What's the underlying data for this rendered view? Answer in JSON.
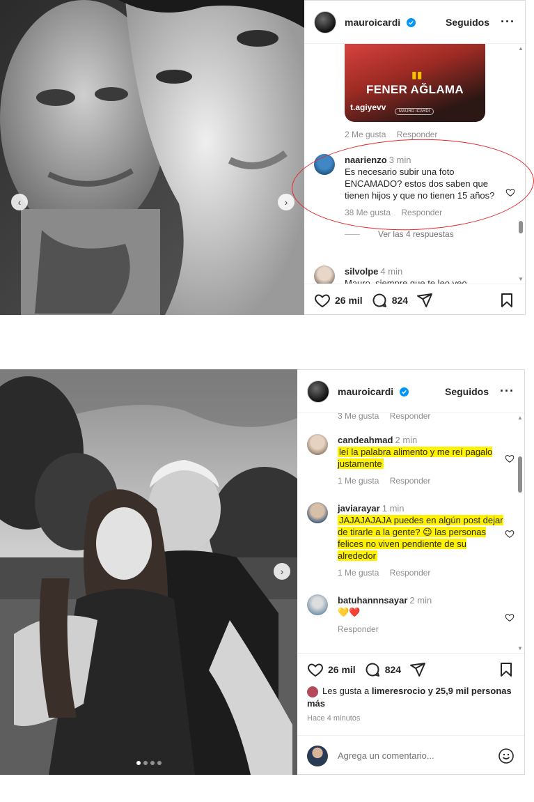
{
  "post1": {
    "header": {
      "username": "mauroicardi",
      "follow_label": "Seguidos",
      "more_label": "···"
    },
    "banner": {
      "title": "FENER AĞLAMA",
      "handle": "t.agiyevv",
      "tag": "MAURO ICARDI",
      "marks": "▮▮"
    },
    "comment_prev": {
      "likes": "2 Me gusta",
      "reply": "Responder"
    },
    "comment_main": {
      "user": "naarienzo",
      "time": "3 min",
      "text": "Es necesario subir una foto ENCAMADO? estos dos saben que tienen hijos y que no tienen 15 años?",
      "likes": "38 Me gusta",
      "reply": "Responder",
      "view_replies": "Ver las 4 respuestas"
    },
    "comment_next": {
      "user": "silvolpe",
      "time": "4 min",
      "text": "Mauro, siempre que te leo veo"
    },
    "actions": {
      "likes": "26 mil",
      "comments": "824"
    },
    "nav": {
      "prev": "‹",
      "next": "›"
    }
  },
  "post2": {
    "header": {
      "username": "mauroicardi",
      "follow_label": "Seguidos",
      "more_label": "···"
    },
    "comment_prev": {
      "likes": "3 Me gusta",
      "reply": "Responder"
    },
    "comments": [
      {
        "user": "candeahmad",
        "time": "2 min",
        "text": "leí la palabra alimento y me reí pagalo justamente",
        "likes": "1 Me gusta",
        "reply": "Responder"
      },
      {
        "user": "javiarayar",
        "time": "1 min",
        "text": "JAJAJAJAJA puedes en algún post dejar de tirarle a la gente? 😉 las personas felices no viven pendiente de su alrededor",
        "likes": "1 Me gusta",
        "reply": "Responder"
      },
      {
        "user": "batuhannnsayar",
        "time": "2 min",
        "text": "💛❤️",
        "reply": "Responder"
      }
    ],
    "actions": {
      "likes": "26 mil",
      "comments": "824"
    },
    "liked_by": {
      "prefix": "Les gusta a ",
      "user": "limeresrocio",
      "suffix": " y 25,9 mil personas más"
    },
    "time_ago": "Hace 4 minutos",
    "add_comment": {
      "placeholder": "Agrega un comentario..."
    },
    "nav": {
      "next": "›"
    }
  },
  "colors": {
    "highlight": "#fff200",
    "annotation": "#e32a2a",
    "verified": "#0095f6"
  }
}
